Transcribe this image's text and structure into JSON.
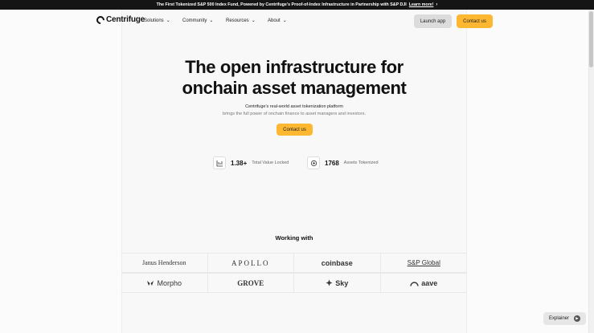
{
  "banner": {
    "text": "The First Tokenized S&P 500 Index Fund, Powered by Centrifuge's Proof-of-Index Infrastructure in Partnership with S&P DJI",
    "link": "Learn more!",
    "chevron": "›"
  },
  "nav": {
    "brand": "Centrifuge",
    "menu": [
      {
        "label": "Solutions",
        "chevron": "⌄"
      },
      {
        "label": "Community",
        "chevron": "⌄"
      },
      {
        "label": "Resources",
        "chevron": "⌄"
      },
      {
        "label": "About",
        "chevron": "⌄"
      }
    ],
    "launch_app": "Launch app",
    "contact_us": "Contact us"
  },
  "hero": {
    "title_line1": "The open infrastructure for",
    "title_line2": "onchain asset management",
    "subtitle_line1": "Centrifuge's real-world asset tokenization platform",
    "subtitle_line2": "brings the full power of onchain finance to asset managers and investors.",
    "cta": "Contact us"
  },
  "stats": [
    {
      "icon": "chart-icon",
      "value": "1.38+",
      "label": "Total Value Locked"
    },
    {
      "icon": "asset-icon",
      "value": "1768",
      "label": "Assets Tokenized"
    }
  ],
  "partners": {
    "heading": "Working with",
    "logos": [
      "Janus Henderson",
      "APOLLO",
      "coinbase",
      "S&P Global",
      "Morpho",
      "GROVE",
      "Sky",
      "aave"
    ]
  },
  "explainer": {
    "label": "Explainer"
  },
  "colors": {
    "accent": "#fdb731",
    "banner_bg": "#151515",
    "page_bg": "#fbfbfb"
  }
}
